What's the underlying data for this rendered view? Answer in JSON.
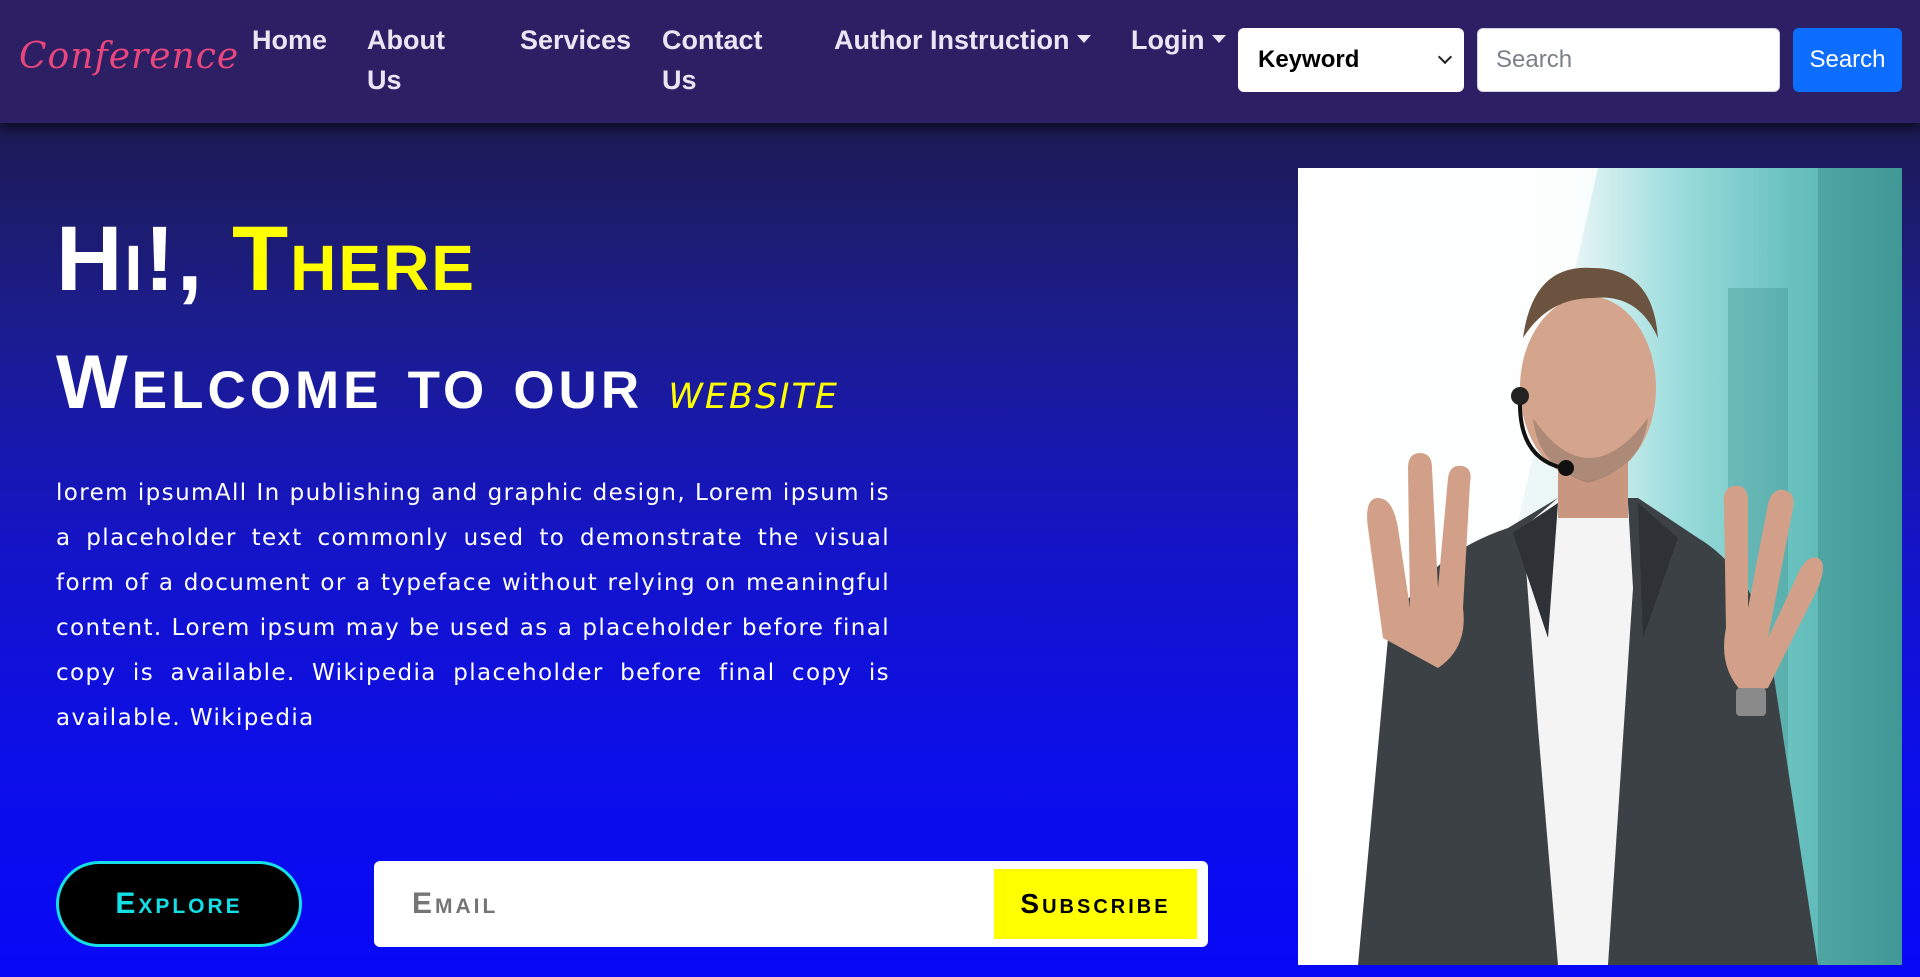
{
  "nav": {
    "brand": "Conference",
    "links": [
      {
        "label": "Home"
      },
      {
        "label": "About Us"
      },
      {
        "label": "Services"
      },
      {
        "label": "Contact Us"
      },
      {
        "label": "Author Instruction"
      },
      {
        "label": "Login"
      }
    ],
    "search_select_value": "Keyword",
    "search_placeholder": "Search",
    "search_button": "Search"
  },
  "hero": {
    "greeting_prefix": "Hi!, ",
    "greeting_highlight": "There",
    "welcome_text": "Welcome to our ",
    "welcome_highlight": "website",
    "paragraph": "lorem ipsumAll In publishing and graphic design, Lorem ipsum is a placeholder text commonly used to demonstrate the visual form of a document or a typeface without relying on meaningful content. Lorem ipsum may be used as a placeholder before final copy is available. Wikipedia placeholder before final copy is available. Wikipedia",
    "explore_button": "Explore",
    "email_placeholder": "Email",
    "subscribe_button": "Subscribe"
  },
  "colors": {
    "navbar_bg": "#2d1f63",
    "brand": "#e8467c",
    "highlight_yellow": "#ffff00",
    "accent_cyan": "#13dfe6",
    "primary_blue": "#0d6efd"
  }
}
